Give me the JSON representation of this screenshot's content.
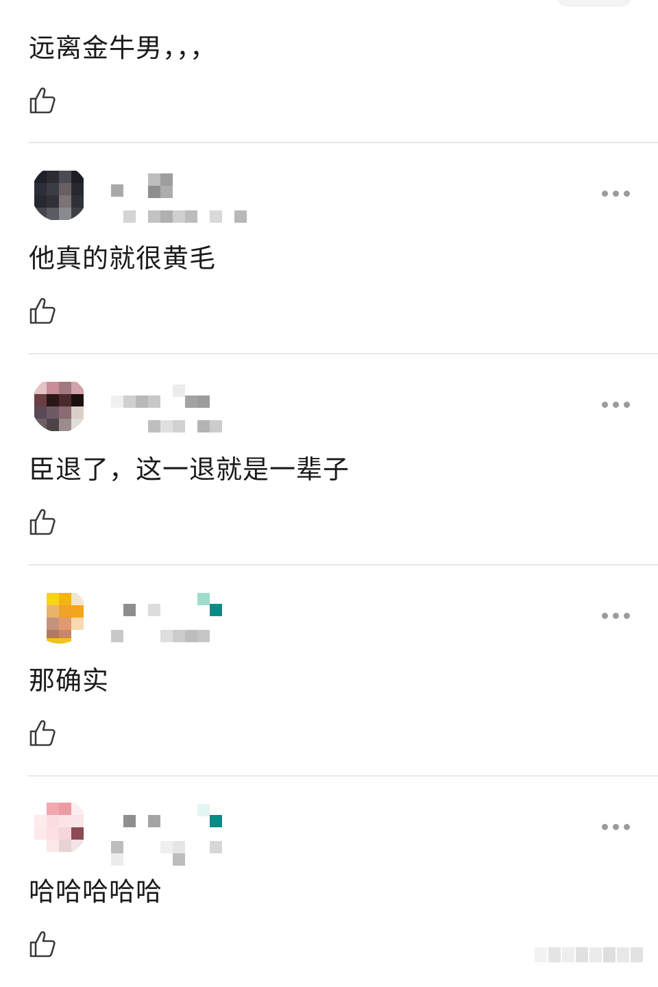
{
  "comments": [
    {
      "text": "远离金牛男，，，",
      "avatar_icon": "avatar-pixelated",
      "username_obscured": true
    },
    {
      "text": "他真的就很黄毛",
      "avatar_icon": "avatar-pixelated",
      "username_obscured": true
    },
    {
      "text": "臣退了，这一退就是一辈子",
      "avatar_icon": "avatar-pixelated",
      "username_obscured": true
    },
    {
      "text": "那确实",
      "avatar_icon": "avatar-pixelated",
      "username_obscured": true
    },
    {
      "text": "哈哈哈哈哈",
      "avatar_icon": "avatar-pixelated",
      "username_obscured": true
    }
  ],
  "icons": {
    "like": "thumbs-up-icon",
    "more": "more-horizontal-icon"
  },
  "colors": {
    "text": "#1a1a1a",
    "divider": "#e9e9e9",
    "icon": "#3a3a3a",
    "more_dots": "#9b9b9b"
  }
}
